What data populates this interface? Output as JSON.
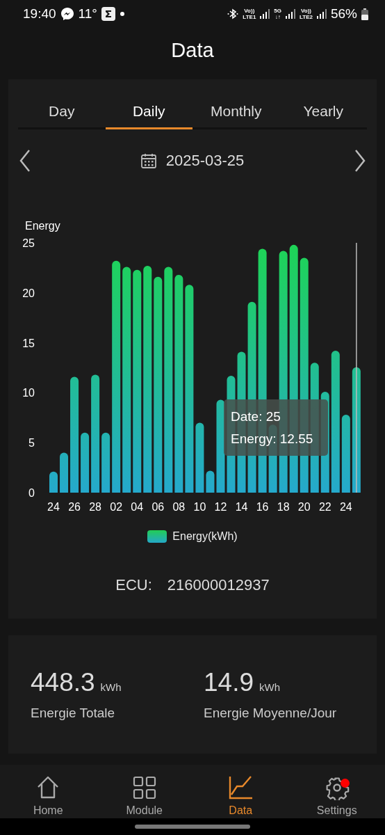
{
  "status_bar": {
    "time": "19:40",
    "temperature": "11°",
    "network": [
      {
        "top": "Vo))",
        "bottom": "LTE1"
      },
      {
        "top": "5G",
        "bottom": "↓↑"
      },
      {
        "top": "Vo))",
        "bottom": "LTE2"
      }
    ],
    "battery": "56%"
  },
  "header": {
    "title": "Data"
  },
  "tabs": [
    {
      "label": "Day",
      "selected": false
    },
    {
      "label": "Daily",
      "selected": true
    },
    {
      "label": "Monthly",
      "selected": false
    },
    {
      "label": "Yearly",
      "selected": false
    }
  ],
  "date_picker": {
    "value": "2025-03-25"
  },
  "chart": {
    "chart_data": {
      "type": "bar",
      "ylabel": "Energy",
      "categories": [
        "24",
        null,
        "26",
        null,
        "28",
        null,
        "02",
        null,
        "04",
        null,
        "06",
        null,
        "08",
        null,
        "10",
        null,
        "12",
        null,
        "14",
        null,
        "16",
        null,
        "18",
        null,
        "20",
        null,
        "22",
        null,
        "24",
        null
      ],
      "series": [
        {
          "name": "Energy(kWh)",
          "values": [
            2.1,
            4.0,
            11.6,
            6.0,
            11.8,
            6.0,
            23.2,
            22.6,
            22.3,
            22.7,
            21.6,
            22.6,
            21.8,
            20.8,
            7.0,
            2.2,
            9.3,
            11.7,
            14.1,
            19.1,
            24.4,
            6.8,
            24.2,
            24.8,
            23.5,
            13.0,
            10.1,
            14.2,
            7.8,
            12.55
          ]
        }
      ],
      "ylim": [
        0,
        25
      ],
      "yticks": [
        0,
        5,
        10,
        15,
        20,
        25
      ]
    },
    "tooltip": {
      "lines": [
        "Date: 25",
        "Energy: 12.55"
      ]
    }
  },
  "ecu": {
    "label": "ECU:",
    "value": "216000012937"
  },
  "stats": [
    {
      "value": "448.3",
      "unit": "kWh",
      "label": "Energie Totale"
    },
    {
      "value": "14.9",
      "unit": "kWh",
      "label": "Energie Moyenne/Jour"
    }
  ],
  "nav": [
    {
      "label": "Home",
      "selected": false,
      "notification": false
    },
    {
      "label": "Module",
      "selected": false,
      "notification": false
    },
    {
      "label": "Data",
      "selected": true,
      "notification": false
    },
    {
      "label": "Settings",
      "selected": false,
      "notification": true
    }
  ]
}
